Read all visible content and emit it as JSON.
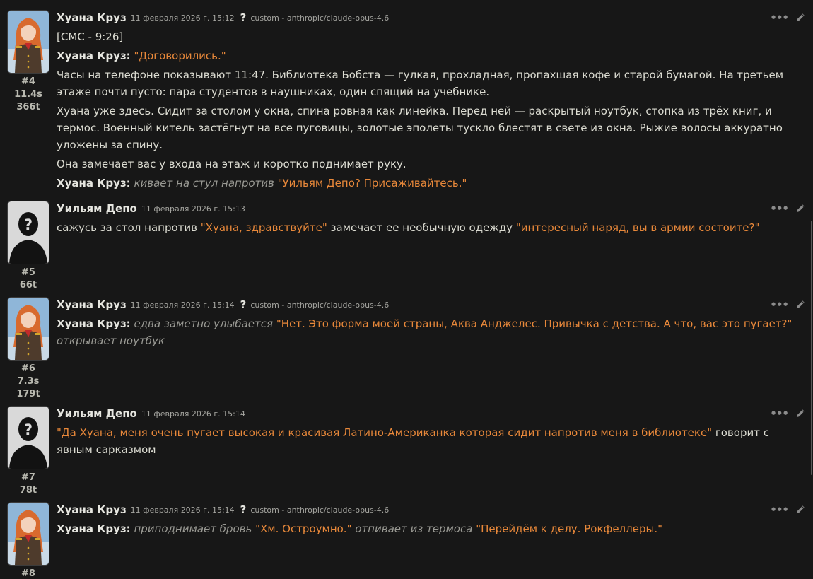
{
  "messages": [
    {
      "name": "Хуана Круз",
      "timestamp": "11 февраля 2026 г. 15:12",
      "help": "?",
      "model": "custom - anthropic/claude-opus-4.6",
      "id": "#4",
      "time": "11.4s",
      "tokens": "366t",
      "avatar": "anime-officer-avatar",
      "body": {
        "p1": "[СМС - 9:26]",
        "p2_name": "Хуана Круз:",
        "p2_quote": "\"Договорились.\"",
        "p3": "Часы на телефоне показывают 11:47. Библиотека Бобста — гулкая, прохладная, пропахшая кофе и старой бумагой. На третьем этаже почти пусто: пара студентов в наушниках, один спящий на учебнике.",
        "p4": "Хуана уже здесь. Сидит за столом у окна, спина ровная как линейка. Перед ней — раскрытый ноутбук, стопка из трёх книг, и термос. Военный китель застёгнут на все пуговицы, золотые эполеты тускло блестят в свете из окна. Рыжие волосы аккуратно уложены за спину.",
        "p5": "Она замечает вас у входа на этаж и коротко поднимает руку.",
        "p6_name": "Хуана Круз:",
        "p6_action": "кивает на стул напротив",
        "p6_quote": "\"Уильям Депо? Присаживайтесь.\""
      }
    },
    {
      "name": "Уильям Депо",
      "timestamp": "11 февраля 2026 г. 15:13",
      "id": "#5",
      "tokens": "66t",
      "avatar": "unknown-user-avatar",
      "body": {
        "t1": "сажусь за стол напротив",
        "q1": "\"Хуана, здравствуйте\"",
        "t2": "замечает ее необычную одежду",
        "q2": "\"интересный наряд, вы в армии состоите?\""
      }
    },
    {
      "name": "Хуана Круз",
      "timestamp": "11 февраля 2026 г. 15:14",
      "help": "?",
      "model": "custom - anthropic/claude-opus-4.6",
      "id": "#6",
      "time": "7.3s",
      "tokens": "179t",
      "avatar": "anime-officer-avatar",
      "body": {
        "name": "Хуана Круз:",
        "action1": "едва заметно улыбается",
        "quote1": "\"Нет. Это форма моей страны, Аква Анджелес. Привычка с детства. А что, вас это пугает?\"",
        "action2": "открывает ноутбук"
      }
    },
    {
      "name": "Уильям Депо",
      "timestamp": "11 февраля 2026 г. 15:14",
      "id": "#7",
      "tokens": "78t",
      "avatar": "unknown-user-avatar",
      "body": {
        "quote": "\"Да Хуана, меня очень пугает высокая и красивая Латино-Американка которая сидит напротив меня в библиотеке\"",
        "text": "говорит с явным сарказмом"
      }
    },
    {
      "name": "Хуана Круз",
      "timestamp": "11 февраля 2026 г. 15:14",
      "help": "?",
      "model": "custom - anthropic/claude-opus-4.6",
      "id": "#8",
      "avatar": "anime-officer-avatar",
      "body": {
        "name": "Хуана Круз:",
        "action1": "приподнимает бровь",
        "quote1": "\"Хм. Остроумно.\"",
        "action2": "отпивает из термоса",
        "quote2": "\"Перейдём к делу. Рокфеллеры.\""
      }
    }
  ],
  "icons": {
    "more": "ellipsis-icon",
    "edit": "pencil-icon"
  },
  "colors": {
    "background": "#171717",
    "quote": "#e8883a",
    "italic": "#9a9a94",
    "text": "#dcdcd2"
  }
}
